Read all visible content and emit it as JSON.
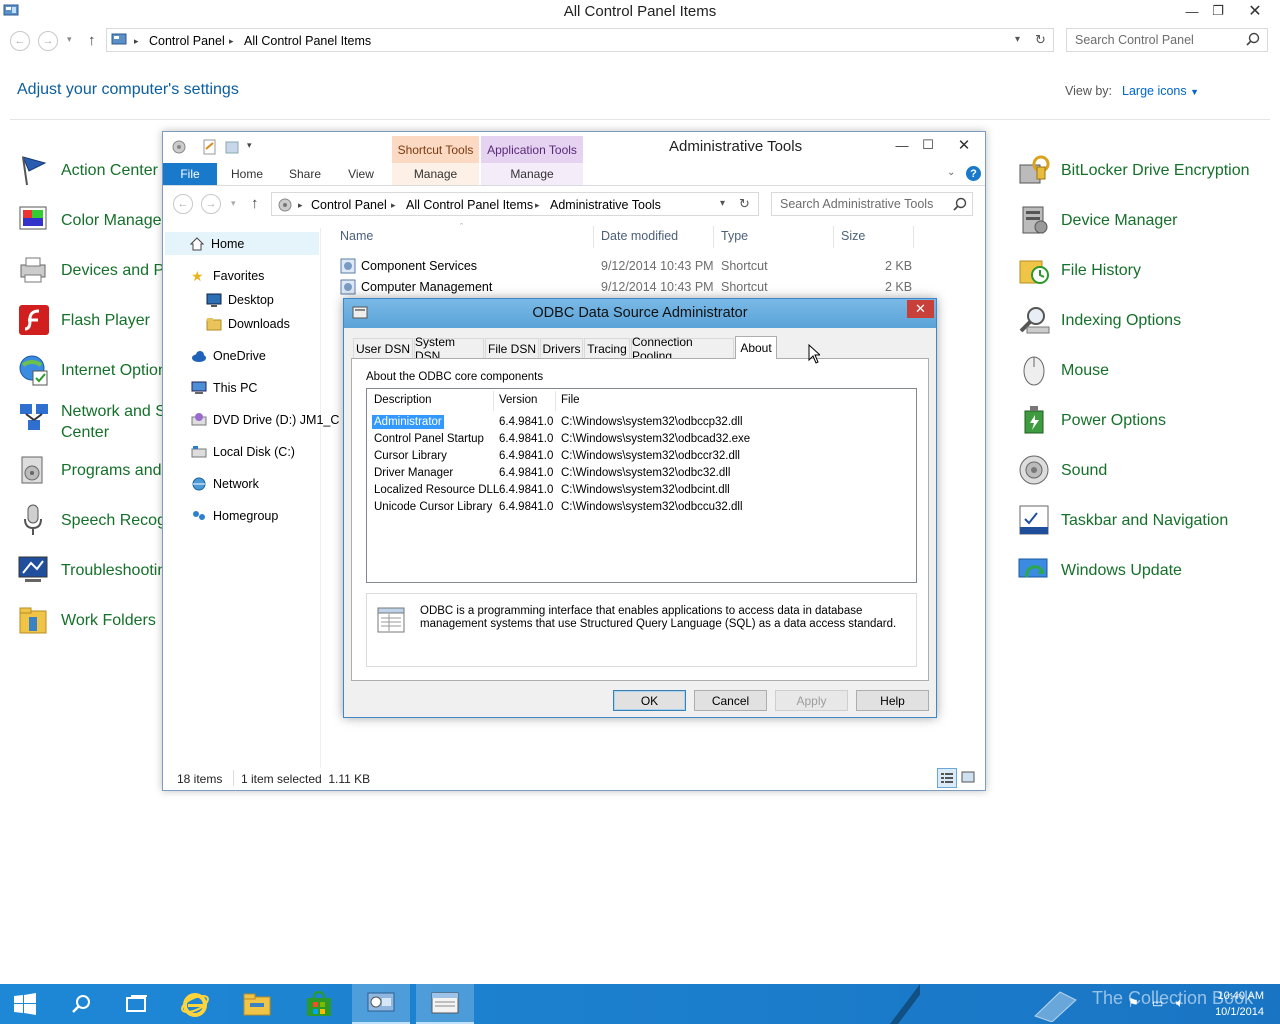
{
  "cp": {
    "title": "All Control Panel Items",
    "breadcrumb": [
      "Control Panel",
      "All Control Panel Items"
    ],
    "search_placeholder": "Search Control Panel",
    "heading": "Adjust your computer's settings",
    "viewby_label": "View by:",
    "viewby_value": "Large icons",
    "left_items": [
      {
        "label": "Action Center",
        "icon": "flag-icon"
      },
      {
        "label": "Color Manage",
        "icon": "color-icon"
      },
      {
        "label": "Devices and Pr",
        "icon": "printer-icon"
      },
      {
        "label": "Flash Player",
        "icon": "flash-icon"
      },
      {
        "label": "Internet Option",
        "icon": "globe-icon"
      },
      {
        "label": "Network and S",
        "label2": "Center",
        "icon": "network-icon"
      },
      {
        "label": "Programs and",
        "icon": "programs-icon"
      },
      {
        "label": "Speech Recogn",
        "icon": "microphone-icon"
      },
      {
        "label": "Troubleshootin",
        "icon": "troubleshoot-icon"
      },
      {
        "label": "Work Folders",
        "icon": "folder-icon"
      }
    ],
    "right_items": [
      {
        "label": "BitLocker Drive Encryption",
        "icon": "bitlocker-icon"
      },
      {
        "label": "Device Manager",
        "icon": "device-manager-icon"
      },
      {
        "label": "File History",
        "icon": "file-history-icon"
      },
      {
        "label": "Indexing Options",
        "icon": "indexing-icon"
      },
      {
        "label": "Mouse",
        "icon": "mouse-icon"
      },
      {
        "label": "Power Options",
        "icon": "power-icon"
      },
      {
        "label": "Sound",
        "icon": "speaker-icon"
      },
      {
        "label": "Taskbar and Navigation",
        "icon": "taskbar-icon"
      },
      {
        "label": "Windows Update",
        "icon": "update-icon"
      }
    ]
  },
  "at": {
    "title": "Administrative Tools",
    "ctx_shortcut": "Shortcut Tools",
    "ctx_app": "Application Tools",
    "tabs": {
      "file": "File",
      "home": "Home",
      "share": "Share",
      "view": "View",
      "manage1": "Manage",
      "manage2": "Manage"
    },
    "breadcrumb": [
      "Control Panel",
      "All Control Panel Items",
      "Administrative Tools"
    ],
    "search_placeholder": "Search Administrative Tools",
    "nav": {
      "home": "Home",
      "favorites": "Favorites",
      "desktop": "Desktop",
      "downloads": "Downloads",
      "onedrive": "OneDrive",
      "thispc": "This PC",
      "dvd": "DVD Drive (D:) JM1_C",
      "localdisk": "Local Disk (C:)",
      "network": "Network",
      "homegroup": "Homegroup"
    },
    "columns": {
      "name": "Name",
      "date": "Date modified",
      "type": "Type",
      "size": "Size"
    },
    "rows": [
      {
        "name": "Component Services",
        "date": "9/12/2014 10:43 PM",
        "type": "Shortcut",
        "size": "2 KB"
      },
      {
        "name": "Computer Management",
        "date": "9/12/2014 10:43 PM",
        "type": "Shortcut",
        "size": "2 KB"
      }
    ],
    "status_items": "18 items",
    "status_selected": "1 item selected  1.11 KB"
  },
  "odbc": {
    "title": "ODBC Data Source Administrator",
    "tabs": [
      "User DSN",
      "System DSN",
      "File DSN",
      "Drivers",
      "Tracing",
      "Connection Pooling",
      "About"
    ],
    "panel_label": "About the ODBC core components",
    "columns": {
      "desc": "Description",
      "version": "Version",
      "file": "File"
    },
    "components": [
      {
        "desc": "Administrator",
        "version": "6.4.9841.0",
        "file": "C:\\Windows\\system32\\odbccp32.dll"
      },
      {
        "desc": "Control Panel Startup",
        "version": "6.4.9841.0",
        "file": "C:\\Windows\\system32\\odbcad32.exe"
      },
      {
        "desc": "Cursor Library",
        "version": "6.4.9841.0",
        "file": "C:\\Windows\\system32\\odbccr32.dll"
      },
      {
        "desc": "Driver Manager",
        "version": "6.4.9841.0",
        "file": "C:\\Windows\\system32\\odbc32.dll"
      },
      {
        "desc": "Localized Resource DLL",
        "version": "6.4.9841.0",
        "file": "C:\\Windows\\system32\\odbcint.dll"
      },
      {
        "desc": "Unicode Cursor Library",
        "version": "6.4.9841.0",
        "file": "C:\\Windows\\system32\\odbccu32.dll"
      }
    ],
    "info_text": "ODBC is a programming interface that enables applications to access data in database management systems that use Structured Query Language (SQL) as a data access standard.",
    "buttons": {
      "ok": "OK",
      "cancel": "Cancel",
      "apply": "Apply",
      "help": "Help"
    }
  },
  "taskbar": {
    "time": "10:40 AM",
    "date": "10/1/2014",
    "watermark": "The Collection Book"
  },
  "colors": {
    "accent": "#1979ca",
    "link_green": "#15702a",
    "selection": "#3399ff",
    "taskbar": "#1b82d0"
  }
}
